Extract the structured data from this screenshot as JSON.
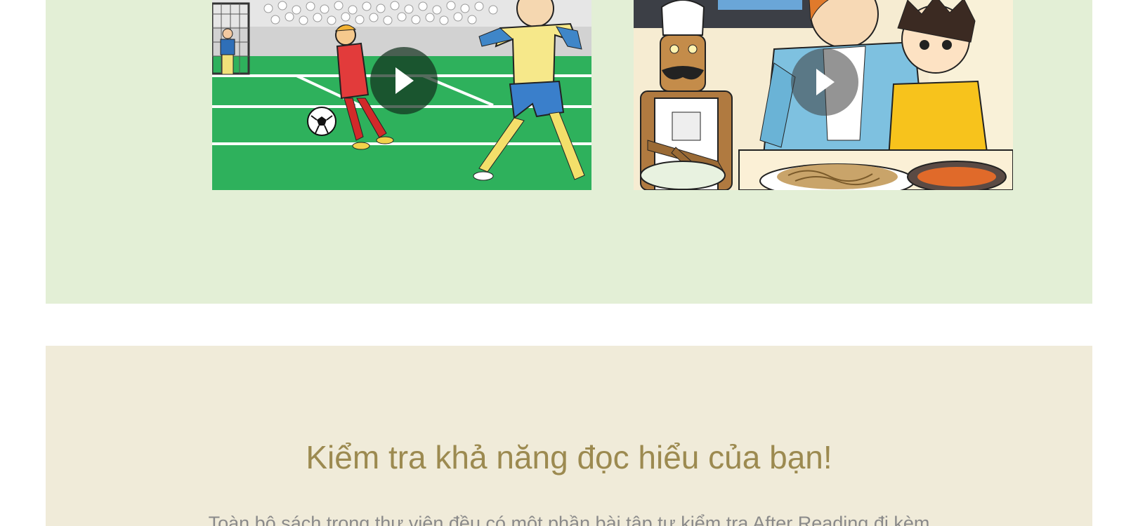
{
  "videos": [
    {
      "label": "Football comic video thumbnail",
      "play_icon": "play-icon"
    },
    {
      "label": "Kitchen comic video thumbnail",
      "play_icon": "play-icon"
    }
  ],
  "reading_check": {
    "heading": "Kiểm tra khả năng đọc hiểu của bạn!",
    "body": "Toàn bộ sách trong thư viện đều có một phần bài tập tự kiểm tra After Reading đi kèm"
  },
  "colors": {
    "green_section_bg": "#e3efd6",
    "beige_section_bg": "#f0ebd9",
    "heading_color": "#9c8a50",
    "body_color": "#8a8a8a"
  }
}
